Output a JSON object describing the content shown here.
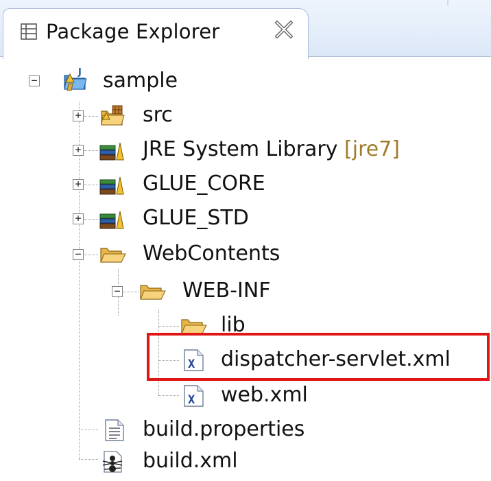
{
  "view": {
    "title": "Package Explorer",
    "icon": "package-explorer-icon",
    "close_icon": "close-icon"
  },
  "tree": {
    "project": {
      "label": "sample",
      "icon": "java-project-icon",
      "expanded": true
    },
    "items": [
      {
        "label": "src",
        "icon": "source-folder-icon",
        "expanded": false
      },
      {
        "label": "JRE System Library",
        "decoration": "[jre7]",
        "icon": "library-icon",
        "expanded": false
      },
      {
        "label": "GLUE_CORE",
        "icon": "library-icon",
        "expanded": false
      },
      {
        "label": "GLUE_STD",
        "icon": "library-icon",
        "expanded": false
      },
      {
        "label": "WebContents",
        "icon": "folder-open-icon",
        "expanded": true
      },
      {
        "label": "WEB-INF",
        "icon": "folder-open-icon",
        "expanded": true
      },
      {
        "label": "lib",
        "icon": "folder-open-icon"
      },
      {
        "label": "dispatcher-servlet.xml",
        "icon": "xml-file-icon",
        "highlighted": true
      },
      {
        "label": "web.xml",
        "icon": "xml-file-icon"
      },
      {
        "label": "build.properties",
        "icon": "properties-file-icon"
      },
      {
        "label": "build.xml",
        "icon": "ant-build-file-icon"
      }
    ]
  },
  "colors": {
    "highlight_border": "#e01515",
    "header_bg": "#dce8f8",
    "decoration_text": "#a07c28"
  }
}
